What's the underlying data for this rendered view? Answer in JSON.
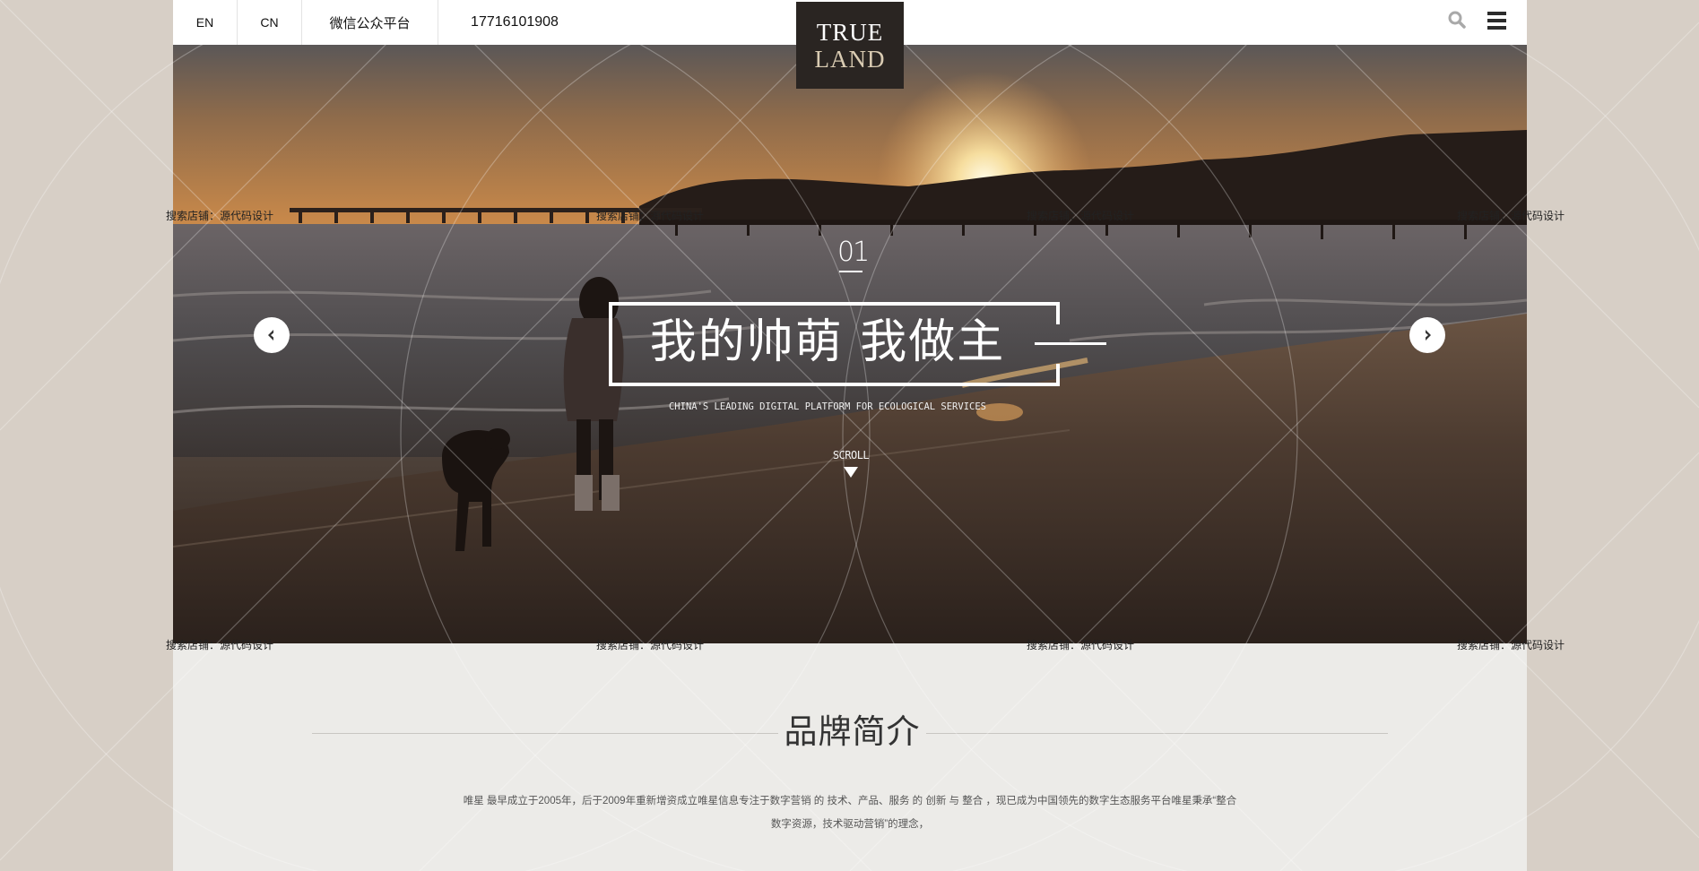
{
  "topbar": {
    "lang_en": "EN",
    "lang_cn": "CN",
    "wechat": "微信公众平台",
    "phone": "17716101908"
  },
  "logo": {
    "line1": "TRUE",
    "line2": "LAND"
  },
  "icons": {
    "search": "search-icon",
    "menu": "menu-icon",
    "prev": "chevron-left-icon",
    "next": "chevron-right-icon",
    "scroll": "triangle-down-icon"
  },
  "hero": {
    "slide_number": "01",
    "title": "我的帅萌 我做主",
    "subtitle": "CHINA'S LEADING DIGITAL PLATFORM FOR ECOLOGICAL SERVICES",
    "scroll_label": "SCROLL"
  },
  "watermark": {
    "text": "搜索店铺：源代码设计"
  },
  "brand": {
    "title": "品牌简介",
    "paragraph_line1": "唯星 最早成立于2005年，后于2009年重新增资成立唯星信息专注于数字营销 的 技术、产品、服务 的 创新 与 整合 ，现已成为中国领先的数字生态服务平台唯星秉承“整合",
    "paragraph_line2": "数字资源，技术驱动营销”的理念，"
  },
  "colors": {
    "outer_bg": "#d7cfc6",
    "page_bg": "#ecebe8",
    "logo_bg": "#2a2522",
    "logo_accent": "#d9cbb2"
  }
}
